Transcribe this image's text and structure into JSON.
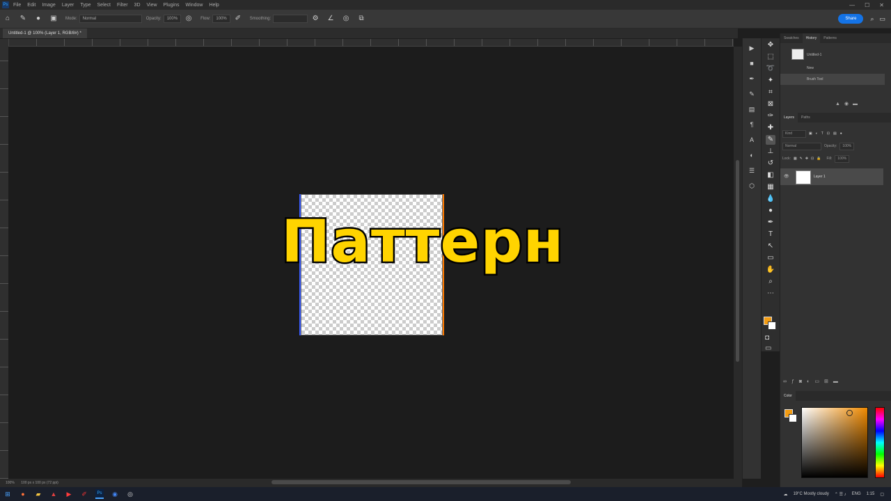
{
  "menubar": {
    "app_icon": "Ps",
    "items": [
      "File",
      "Edit",
      "Image",
      "Layer",
      "Type",
      "Select",
      "Filter",
      "3D",
      "View",
      "Plugins",
      "Window",
      "Help"
    ],
    "window_controls": [
      "—",
      "☐",
      "✕"
    ]
  },
  "options_bar": {
    "mode_label": "Mode:",
    "mode_value": "Normal",
    "opacity_label": "Opacity:",
    "opacity_value": "100%",
    "flow_label": "Flow:",
    "flow_value": "100%",
    "smoothing_label": "Smoothing:",
    "smoothing_value": "",
    "share_label": "Share"
  },
  "document": {
    "tab_title": "Untitled-1 @ 100% (Layer 1, RGB/8#) *",
    "zoom": "100%",
    "status": "100 px x 100 px (72 ppi)"
  },
  "overlay_title": "Паттерн",
  "history_panel": {
    "tabs": [
      "Swatches",
      "History",
      "Patterns"
    ],
    "active_tab": "History",
    "snapshot": "Untitled-1",
    "states": [
      "New",
      "Brush Tool"
    ]
  },
  "layers_panel": {
    "tabs": [
      "Layers",
      "Paths"
    ],
    "active_tab": "Layers",
    "filter_kind": "Kind",
    "blend_mode": "Normal",
    "opacity_label": "Opacity:",
    "opacity_value": "100%",
    "lock_label": "Lock:",
    "fill_label": "Fill:",
    "fill_value": "100%",
    "layers": [
      {
        "name": "Layer 1"
      }
    ]
  },
  "color_panel": {
    "tab": "Color",
    "foreground": "#f39c12",
    "background": "#ffffff"
  },
  "taskbar": {
    "weather": "19°C  Mostly cloudy",
    "lang": "ENG",
    "time": "1:15"
  },
  "colors": {
    "accent": "#1473e6",
    "title_fill": "#ffd400",
    "title_stroke": "#000000",
    "canvas_bg": "#1c1c1c"
  }
}
